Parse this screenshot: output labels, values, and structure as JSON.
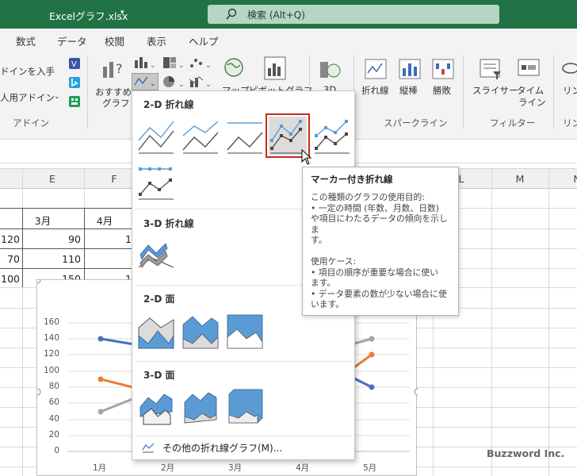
{
  "title_bar": {
    "filename": "Excelグラフ.xlsx",
    "search_placeholder": "検索 (Alt+Q)"
  },
  "tabs": [
    "数式",
    "データ",
    "校閲",
    "表示",
    "ヘルプ"
  ],
  "ribbon": {
    "addin": {
      "get": "ドインを入手",
      "personal": "人用アドイン",
      "group": "アドイン"
    },
    "recommended": [
      "おすすめ",
      "グラフ"
    ],
    "map": "マップ",
    "pivot": "ピボットグラフ",
    "threed": "3D",
    "sparklines": {
      "line": "折れ線",
      "column": "縦棒",
      "winloss": "勝敗",
      "group": "スパークライン"
    },
    "filters": {
      "slicer": "スライサー",
      "timeline": [
        "タイム",
        "ライン"
      ],
      "group": "フィルター"
    },
    "links": [
      "リン",
      "リン"
    ]
  },
  "columns": [
    "E",
    "F",
    "L",
    "M",
    "N"
  ],
  "cells": {
    "month_e": "3月",
    "month_f": "4月",
    "r1": [
      "120",
      "90",
      "1"
    ],
    "r2": [
      "70",
      "110"
    ],
    "r3": [
      "100",
      "150",
      "1"
    ]
  },
  "chart": {
    "y_ticks": [
      "160",
      "140",
      "120",
      "100",
      "80",
      "60",
      "40",
      "20",
      "0"
    ],
    "x_ticks": [
      "1月",
      "2月",
      "3月",
      "4月",
      "5月"
    ]
  },
  "menu": {
    "sec_2d_line": "2-D 折れ線",
    "sec_3d_line": "3-D 折れ線",
    "sec_2d_area": "2-D 面",
    "sec_3d_area": "3-D 面",
    "more": "その他の折れ線グラフ(M)..."
  },
  "tooltip": {
    "title": "マーカー付き折れ線",
    "lines": [
      "この種類のグラフの使用目的:",
      "• 一定の時間 (年数、月数、日数)",
      "や項目にわたるデータの傾向を示しま",
      "す。",
      "",
      "使用ケース:",
      "• 項目の順序が重要な場合に使い",
      "ます。",
      "• データ要素の数が少ない場合に使",
      "います。"
    ]
  },
  "watermark": "Buzzword Inc.",
  "colors": {
    "excel_green": "#217346",
    "selected_border": "#c42b1c",
    "line_blue": "#4472c4",
    "line_orange": "#ed7d31",
    "line_gray": "#a5a5a5"
  }
}
